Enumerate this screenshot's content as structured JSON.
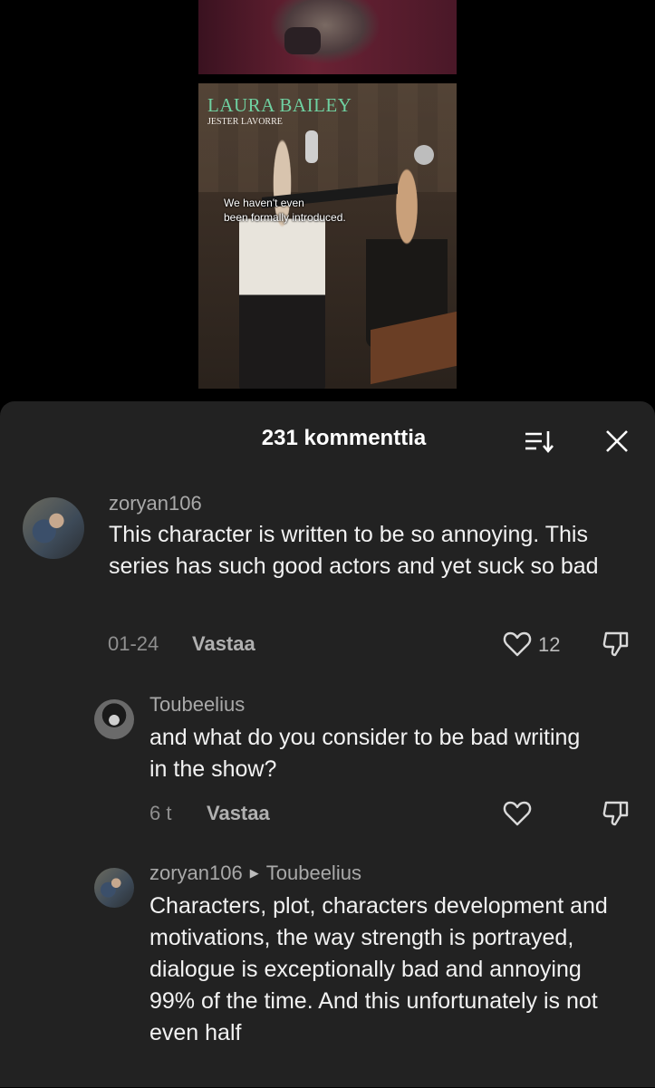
{
  "video": {
    "credit_name": "LAURA BAILEY",
    "credit_role": "JESTER LAVORRE",
    "subtitle": "We haven't even\nbeen formally introduced."
  },
  "comments_panel": {
    "title": "231 kommenttia",
    "icons": {
      "sort": "sort-icon",
      "close": "close-icon"
    }
  },
  "comments": [
    {
      "username": "zoryan106",
      "text": "This character is written to be so annoying. This series has such good actors and yet suck so bad",
      "date": "01-24",
      "reply_label": "Vastaa",
      "likes": "12"
    },
    {
      "username": "Toubeelius",
      "text": "and what do you consider to be bad writing in the show?",
      "date": "6 t",
      "reply_label": "Vastaa"
    },
    {
      "username": "zoryan106",
      "reply_to": "Toubeelius",
      "text": "Characters, plot, characters development and motivations, the way strength is portrayed, dialogue is exceptionally bad and annoying 99% of the time. And this unfortunately is not even half"
    }
  ]
}
